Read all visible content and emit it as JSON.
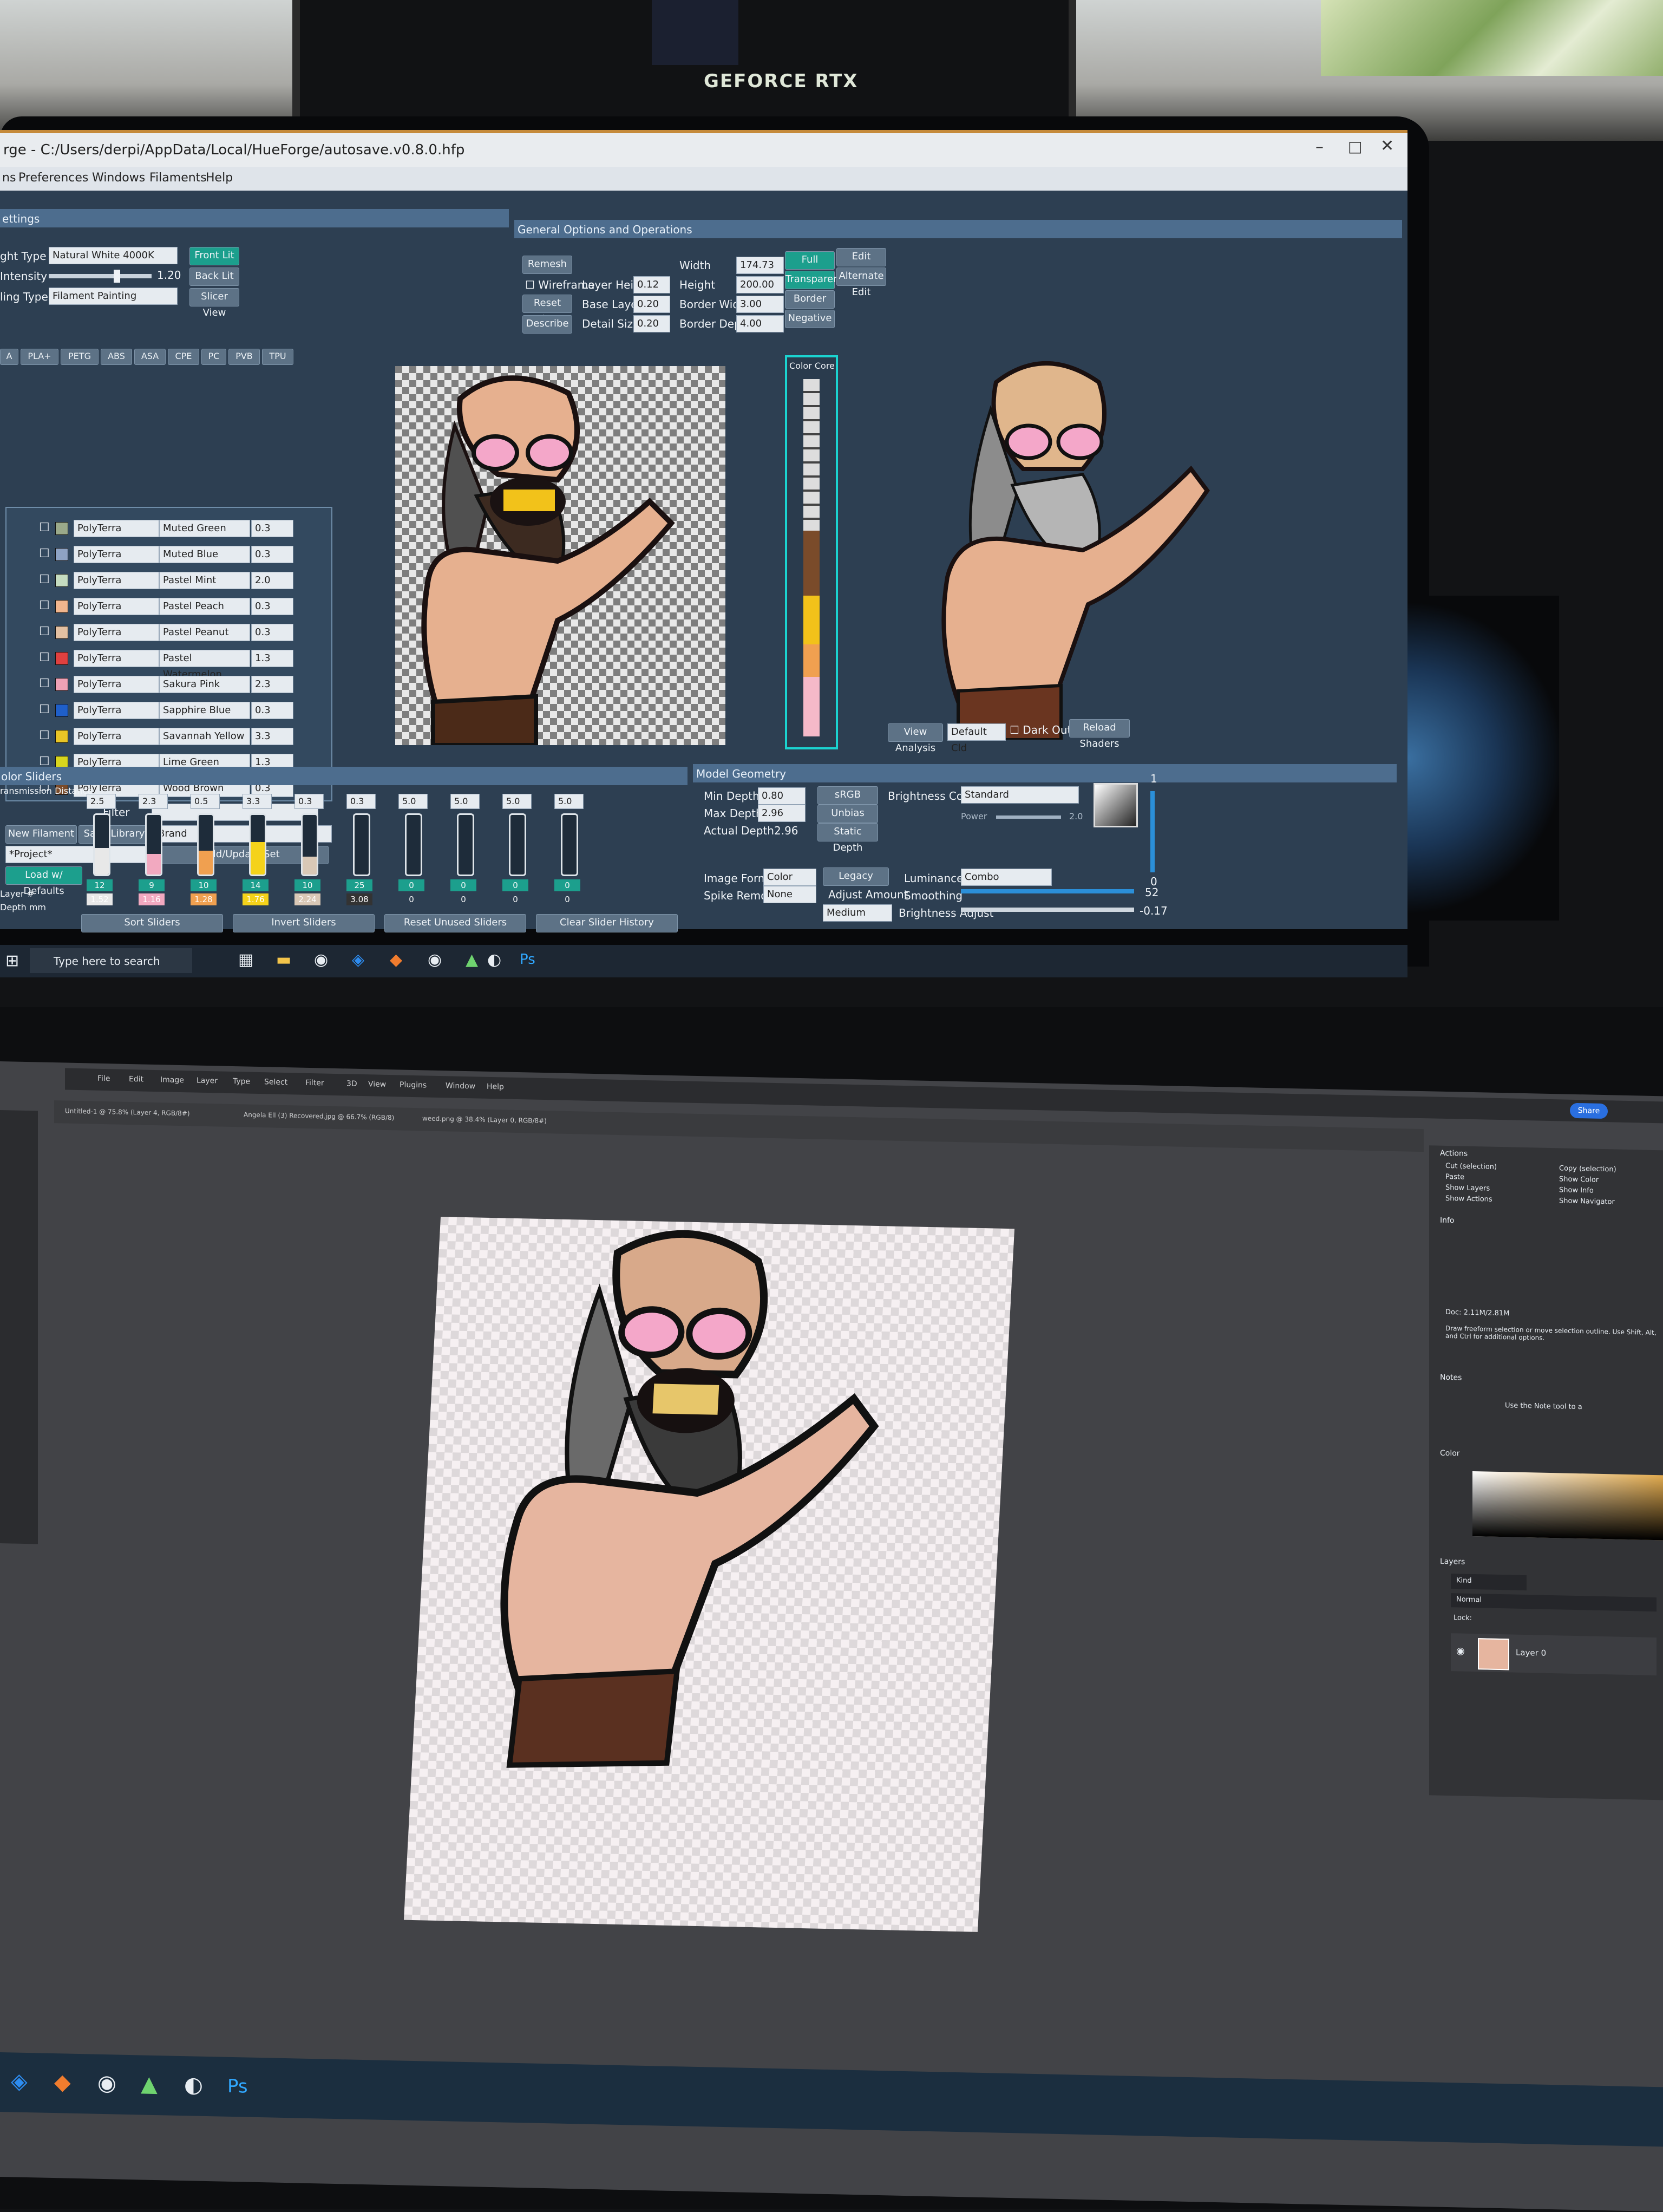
{
  "room": {
    "gpu_label": "GEFORCE RTX"
  },
  "hueforge": {
    "window_title": "rge - C:/Users/derpi/AppData/Local/HueForge/autosave.v0.8.0.hfp",
    "menu": [
      "ns",
      "Preferences",
      "Windows",
      "Filaments",
      "Help"
    ],
    "settings_panel": {
      "title": "ettings",
      "light_type_label": "ght Type",
      "light_type_value": "Natural White 4000K",
      "intensity_label": "Intensity",
      "intensity_value": "1.20",
      "filling_type_label": "ling Type",
      "filling_type_value": "Filament Painting",
      "front_lit": "Front Lit",
      "back_lit": "Back Lit",
      "slicer_view": "Slicer View",
      "material_tabs": [
        "A",
        "PLA+",
        "PETG",
        "ABS",
        "ASA",
        "CPE",
        "PC",
        "PVB",
        "TPU"
      ]
    },
    "general_options": {
      "title": "General Options and Operations",
      "remesh": "Remesh",
      "wireframe": "Wireframe",
      "reset_view": "Reset View",
      "describe": "Describe",
      "layer_height_label": "Layer Height",
      "layer_height": "0.12",
      "base_layer_label": "Base Layer",
      "base_layer": "0.20",
      "detail_size_label": "Detail Size",
      "detail_size": "0.20",
      "width_label": "Width",
      "width": "174.73",
      "height_label": "Height",
      "height": "200.00",
      "border_width_label": "Border Width",
      "border_width": "3.00",
      "border_depth_label": "Border Depth",
      "border_depth": "4.00",
      "full_range": "Full Range",
      "edit_image": "Edit Image",
      "transparent": "Transparent",
      "alternate_edit": "Alternate Edit",
      "border": "Border",
      "negative": "Negative"
    },
    "filaments": [
      {
        "brand": "PolyTerra",
        "name": "Muted Green",
        "td": "0.3",
        "color": "#9aa98a"
      },
      {
        "brand": "PolyTerra",
        "name": "Muted Blue",
        "td": "0.3",
        "color": "#8ea3c4"
      },
      {
        "brand": "PolyTerra",
        "name": "Pastel Mint",
        "td": "2.0",
        "color": "#c5dcc0"
      },
      {
        "brand": "PolyTerra",
        "name": "Pastel Peach",
        "td": "0.3",
        "color": "#f1b58d"
      },
      {
        "brand": "PolyTerra",
        "name": "Pastel Peanut",
        "td": "0.3",
        "color": "#e3c0a2"
      },
      {
        "brand": "PolyTerra",
        "name": "Pastel Watermelon",
        "td": "1.3",
        "color": "#e0403f"
      },
      {
        "brand": "PolyTerra",
        "name": "Sakura Pink",
        "td": "2.3",
        "color": "#eea1b6"
      },
      {
        "brand": "PolyTerra",
        "name": "Sapphire Blue",
        "td": "0.3",
        "color": "#1f5fc9"
      },
      {
        "brand": "PolyTerra",
        "name": "Savannah Yellow",
        "td": "3.3",
        "color": "#e9c526"
      },
      {
        "brand": "PolyTerra",
        "name": "Lime Green",
        "td": "1.3",
        "color": "#d8d61e"
      },
      {
        "brand": "PolyTerra",
        "name": "Wood Brown",
        "td": "0.3",
        "color": "#7a4b2a"
      }
    ],
    "filter_label": "Filter",
    "new_filament": "New Filament",
    "save_library": "Save Library",
    "brand_field": "Brand",
    "project_field": "*Project*",
    "add_update_set": "Add/Update Set",
    "load_defaults": "Load w/ Defaults",
    "color_core_label": "Color Core",
    "view_analysis": "View Analysis",
    "default_cld": "Default Cld",
    "dark_outer": "Dark Outer",
    "reload_shaders": "Reload Shaders",
    "sliders_panel": {
      "title": "olor Sliders",
      "transmission_label": "ransmission Distance",
      "layer_label": "Layer #",
      "depth_label": "Depth mm",
      "td_values": [
        "2.5",
        "2.3",
        "0.5",
        "3.3",
        "0.3",
        "0.3",
        "5.0",
        "5.0",
        "5.0",
        "5.0"
      ],
      "layer_values": [
        "12",
        "9",
        "10",
        "14",
        "10",
        "25",
        "0",
        "0",
        "0",
        "0"
      ],
      "depth_values": [
        "1.52",
        "1.16",
        "1.28",
        "1.76",
        "2.24",
        "3.08",
        "0",
        "0",
        "0",
        "0"
      ],
      "fill_colors": [
        "#e8e8e8",
        "#f2a9c0",
        "#f0a050",
        "#f4d21a",
        "#d9c8b6",
        "#333333",
        "#2d3f52",
        "#2d3f52",
        "#2d3f52",
        "#2d3f52"
      ],
      "fill_levels": [
        0.45,
        0.35,
        0.4,
        0.55,
        0.3,
        0.0,
        0,
        0,
        0,
        0
      ],
      "sort_sliders": "Sort Sliders",
      "invert_sliders": "Invert Sliders",
      "reset_unused": "Reset Unused Sliders",
      "clear_history": "Clear Slider History"
    },
    "model_geometry": {
      "title": "Model Geometry",
      "min_depth_label": "Min Depth",
      "min_depth": "0.80",
      "max_depth_label": "Max Depth",
      "max_depth": "2.96",
      "actual_depth_label": "Actual Depth",
      "actual_depth": "2.96",
      "srgb": "sRGB",
      "unbias_lighting": "Unbias Lighting",
      "static_depth": "Static Depth",
      "brightness_comp_label": "Brightness Comp",
      "brightness_comp": "Standard",
      "power_label": "Power",
      "power_value": "2.0",
      "image_format_label": "Image Format",
      "image_format": "Color",
      "legacy": "Legacy",
      "spike_removal_label": "Spike Removal",
      "spike_removal": "None",
      "adjust_amount": "Adjust Amount",
      "medium": "Medium",
      "luminance_label": "Luminance",
      "luminance": "Combo",
      "smoothing_label": "Smoothing",
      "brightness_adjust_label": "Brightness Adjust",
      "right_value_top": "1",
      "right_value_mid": "0",
      "value_52": "52",
      "value_neg": "-0.17"
    },
    "taskbar_search": "Type here to search"
  },
  "photoshop": {
    "menu": [
      "File",
      "Edit",
      "Image",
      "Layer",
      "Type",
      "Select",
      "Filter",
      "3D",
      "View",
      "Plugins",
      "Window",
      "Help"
    ],
    "share": "Share",
    "tabs": [
      "Untitled-1 @ 75.8% (Layer 4, RGB/8#)",
      "Angela Ell (3) Recovered.jpg @ 66.7% (RGB/8)",
      "weed.png @ 38.4% (Layer 0, RGB/8#)"
    ],
    "panels": {
      "actions": "Actions",
      "cut": "Cut (selection)",
      "copy": "Copy (selection)",
      "paste": "Paste",
      "show_color": "Show Color",
      "show_layers": "Show Layers",
      "show_info": "Show Info",
      "show_actions": "Show Actions",
      "show_navigator": "Show Navigator",
      "info": "Info",
      "doc_size": "Doc: 2.11M/2.81M",
      "info_hint": "Draw freeform selection or move selection outline. Use Shift, Alt, and Ctrl for additional options.",
      "notes": "Notes",
      "notes_hint": "Use the Note tool to a",
      "color": "Color",
      "layers": "Layers",
      "kind": "Kind",
      "blend": "Normal",
      "lock": "Lock:",
      "layer_name": "Layer 0"
    }
  }
}
